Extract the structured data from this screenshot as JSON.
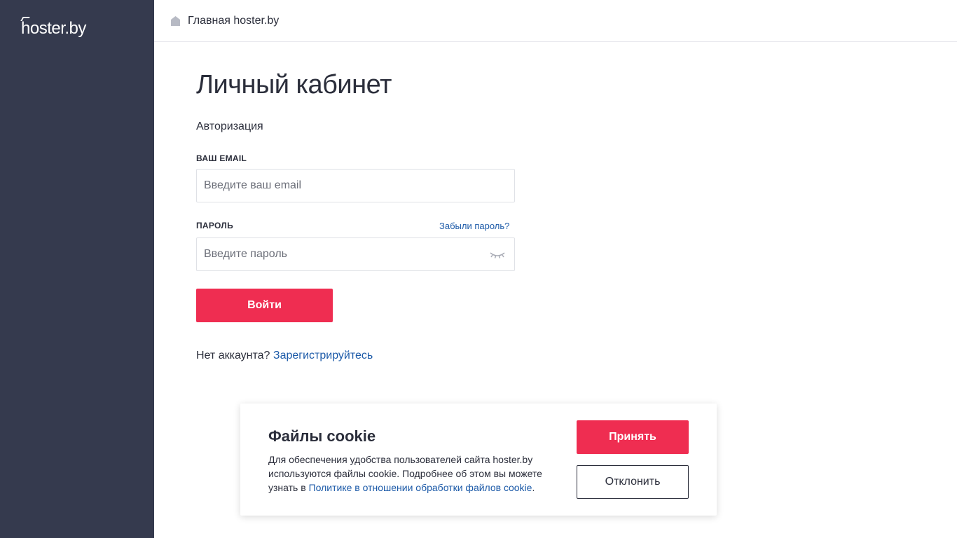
{
  "sidebar": {
    "logo_text": "hoster.by"
  },
  "topbar": {
    "home_icon": "home-icon",
    "breadcrumb": "Главная hoster.by"
  },
  "main": {
    "title": "Личный кабинет",
    "subtitle": "Авторизация",
    "email": {
      "label": "ВАШ EMAIL",
      "placeholder": "Введите ваш email",
      "value": ""
    },
    "password": {
      "label": "ПАРОЛЬ",
      "placeholder": "Введите пароль",
      "value": "",
      "forgot_link": "Забыли пароль?",
      "toggle_icon": "eye-closed-icon"
    },
    "login_button": "Войти",
    "register": {
      "prompt": "Нет аккаунта?",
      "link": "Зарегистрируйтесь"
    }
  },
  "cookie_banner": {
    "title": "Файлы cookie",
    "text": "Для обеспечения удобства пользователей сайта hoster.by используются файлы cookie. Подробнее об этом вы можете узнать в",
    "link": "Политике в отношении обработки файлов cookie",
    "text_end": ".",
    "accept_button": "Принять",
    "decline_button": "Отклонить"
  },
  "colors": {
    "sidebar": "#353a4e",
    "accent": "#ef2d51",
    "link": "#1c5aa8",
    "text": "#2b2e3b"
  }
}
